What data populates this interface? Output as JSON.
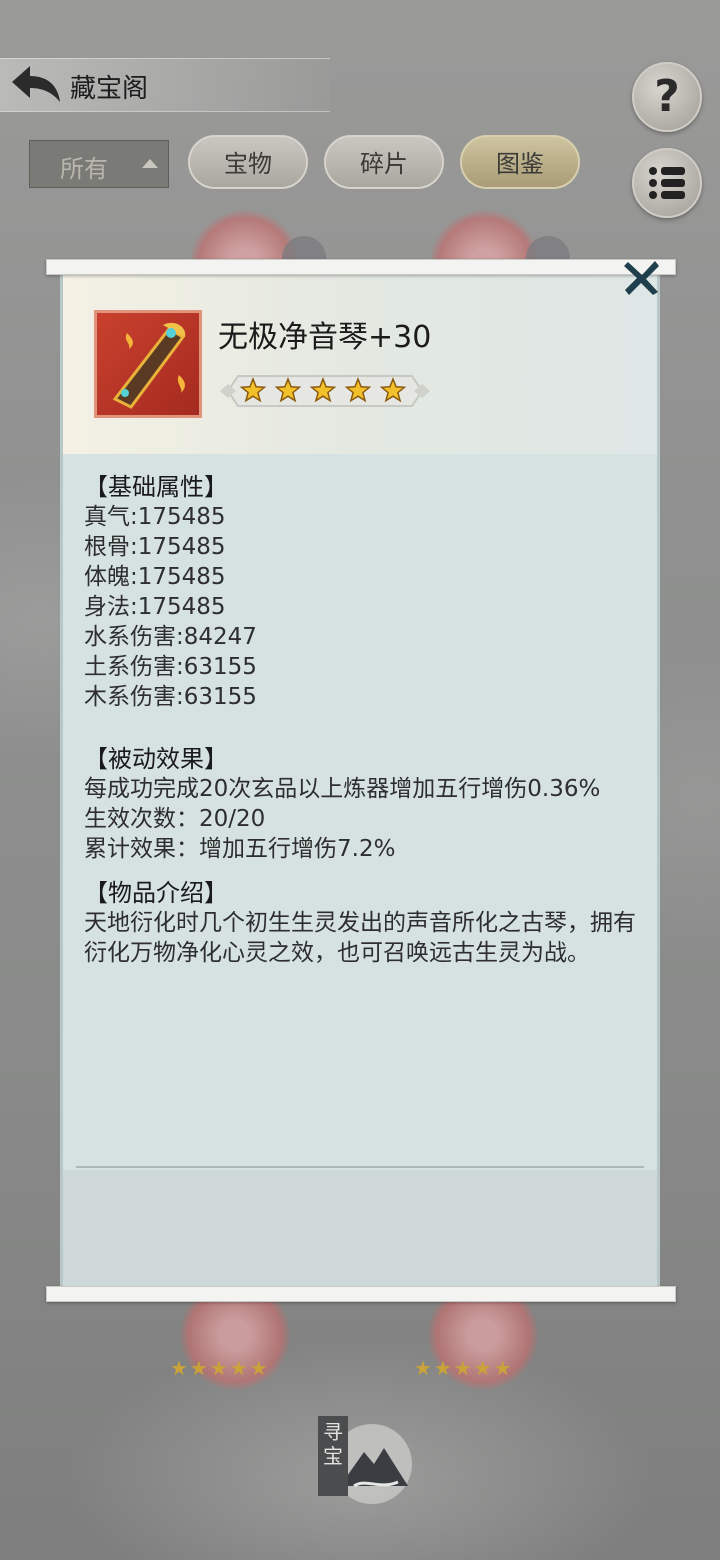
{
  "header": {
    "title": "藏宝阁"
  },
  "filter": {
    "selected": "所有"
  },
  "tabs": [
    {
      "label": "宝物"
    },
    {
      "label": "碎片"
    },
    {
      "label": "图鉴"
    }
  ],
  "help_label": "?",
  "popup": {
    "item_name": "无极净音琴+30",
    "star_count": 5,
    "sections": {
      "base_title": "【基础属性】",
      "base_stats": [
        "真气:175485",
        "根骨:175485",
        "体魄:175485",
        "身法:175485",
        "水系伤害:84247",
        "土系伤害:63155",
        "木系伤害:63155"
      ],
      "passive_title": "【被动效果】",
      "passive_desc": "每成功完成20次玄品以上炼器增加五行增伤0.36%",
      "passive_count": "生效次数：20/20",
      "passive_total": "累计效果：增加五行增伤7.2%",
      "intro_title": "【物品介绍】",
      "intro_text": "天地衍化时几个初生生灵发出的声音所化之古琴，拥有衍化万物净化心灵之效，也可召唤远古生灵为战。"
    }
  },
  "seek_button": {
    "label": "寻宝"
  },
  "colors": {
    "icon_bg": "#b93524",
    "star": "#f2c02a",
    "popup_bg": "#d6e2e2"
  }
}
